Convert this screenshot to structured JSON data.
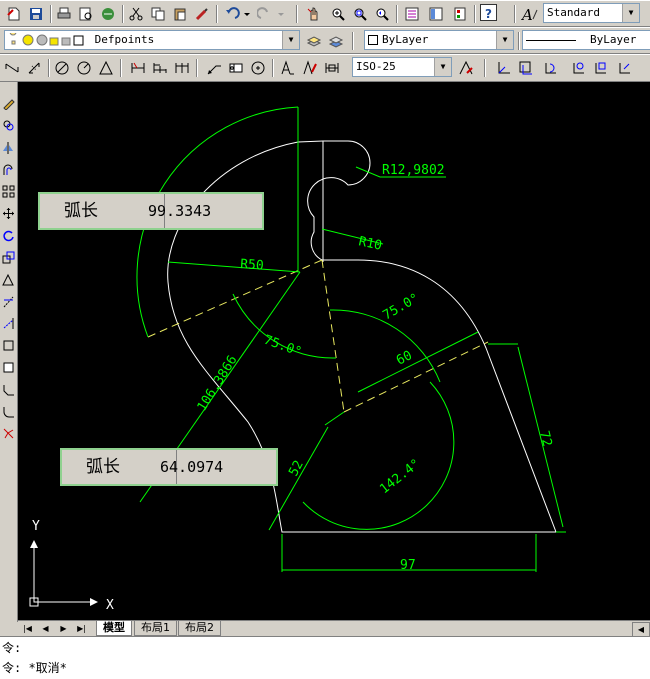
{
  "toolbar1": {
    "text_style_value": "Standard"
  },
  "toolbar2": {
    "layer_value": "Defpoints",
    "color_value": "ByLayer",
    "linetype_value": "ByLayer"
  },
  "toolbar3": {
    "dimstyle_value": "ISO-25"
  },
  "drawing": {
    "dimensions": {
      "radius_small": "R12,9802",
      "radius_10": "R10",
      "radius_50": "R50",
      "angle_left": "75.0°",
      "angle_right": "75.0°",
      "length_60": "60",
      "length_106": "106.3866",
      "length_52": "52",
      "angle_142": "142.4°",
      "length_72": "72",
      "length_97": "97"
    },
    "ucs": {
      "y_label": "Y",
      "x_label": "X"
    },
    "arc_length_top": {
      "label": "弧长",
      "value": "99.3343"
    },
    "arc_length_bottom": {
      "label": "弧长",
      "value": "64.0974"
    }
  },
  "tabs": {
    "model": "模型",
    "layout1": "布局1",
    "layout2": "布局2"
  },
  "command": {
    "line1": "令:",
    "line2": "令: *取消*"
  },
  "colors": {
    "geometry": "#ffffff",
    "dimension": "#00ff00",
    "hidden_line": "#ffff66",
    "canvas": "#000000"
  }
}
